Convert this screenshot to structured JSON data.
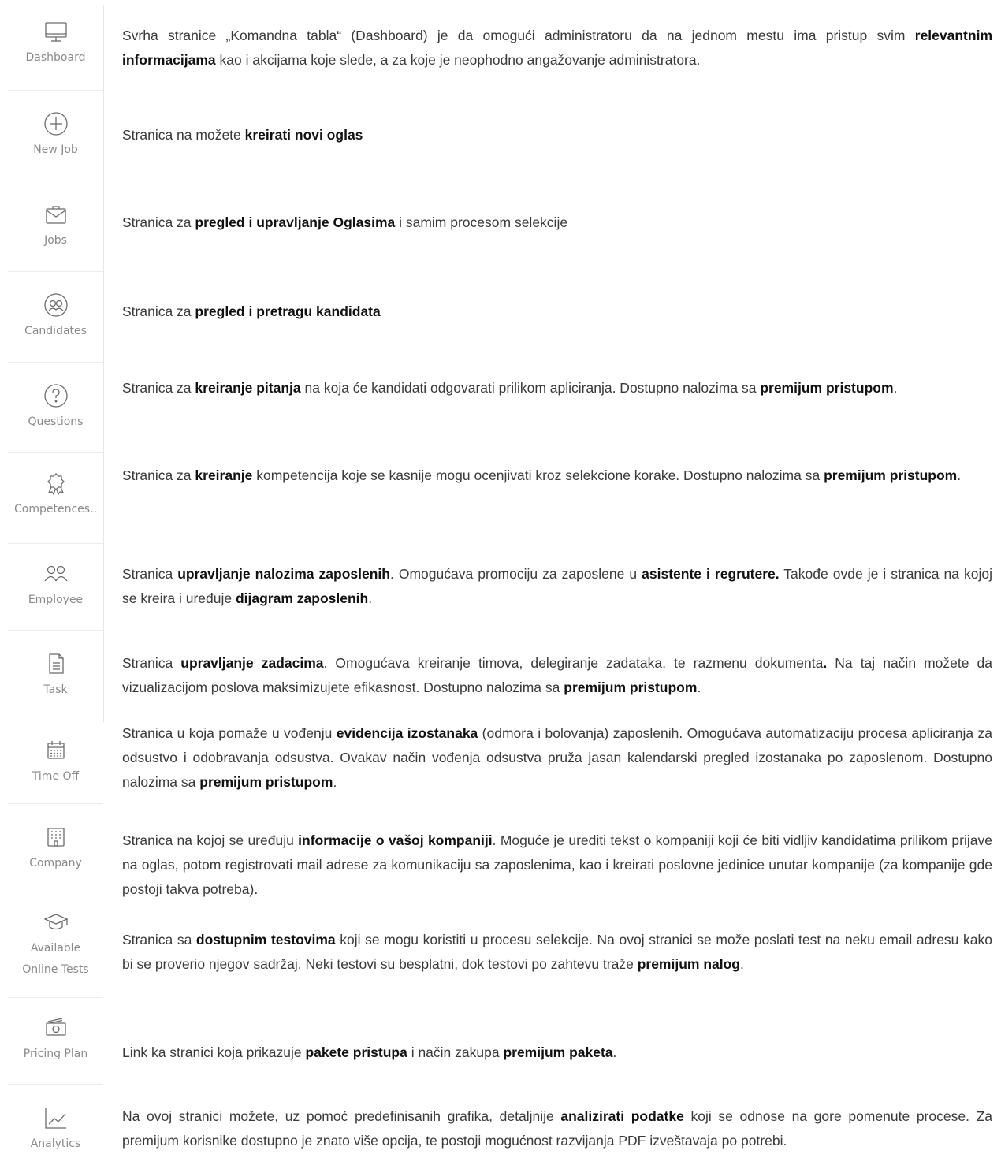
{
  "sidebar": {
    "items": [
      {
        "label": "Dashboard",
        "icon": "monitor-icon"
      },
      {
        "label": "New Job",
        "icon": "plus-circle-icon"
      },
      {
        "label": "Jobs",
        "icon": "briefcase-icon"
      },
      {
        "label": "Candidates",
        "icon": "candidates-icon"
      },
      {
        "label": "Questions",
        "icon": "question-circle-icon"
      },
      {
        "label": "Competences..",
        "icon": "award-icon"
      },
      {
        "label": "Employee",
        "icon": "users-icon"
      },
      {
        "label": "Task",
        "icon": "document-icon"
      },
      {
        "label": "Time Off",
        "icon": "calendar-icon"
      },
      {
        "label": "Company",
        "icon": "building-icon"
      },
      {
        "label": "Available Online Tests",
        "icon": "graduation-cap-icon"
      },
      {
        "label": "Pricing Plan",
        "icon": "money-icon"
      },
      {
        "label": "Analytics",
        "icon": "chart-line-icon"
      }
    ]
  },
  "descriptions": [
    [
      {
        "t": "Svrha stranice „Komandna tabla“ (Dashboard) je da omogući administratoru da na jednom mestu ima pristup svim "
      },
      {
        "t": "relevantnim informacijama",
        "b": true
      },
      {
        "t": " kao i akcijama koje slede, a za koje je neophodno angažovanje administratora."
      }
    ],
    [
      {
        "t": "Stranica na možete "
      },
      {
        "t": "kreirati novi oglas",
        "b": true
      }
    ],
    [
      {
        "t": "Stranica za "
      },
      {
        "t": "pregled i upravljanje Oglasima",
        "b": true
      },
      {
        "t": " i samim procesom selekcije"
      }
    ],
    [
      {
        "t": "Stranica za "
      },
      {
        "t": "pregled i pretragu kandidata",
        "b": true
      }
    ],
    [
      {
        "t": "Stranica za "
      },
      {
        "t": "kreiranje pitanja",
        "b": true
      },
      {
        "t": " na koja će kandidati odgovarati prilikom apliciranja. Dostupno nalozima sa "
      },
      {
        "t": "premijum pristupom",
        "b": true
      },
      {
        "t": "."
      }
    ],
    [
      {
        "t": "Stranica za "
      },
      {
        "t": "kreiranje",
        "b": true
      },
      {
        "t": " kompetencija koje se kasnije mogu ocenjivati kroz selekcione korake. Dostupno nalozima sa "
      },
      {
        "t": "premijum pristupom",
        "b": true
      },
      {
        "t": "."
      }
    ],
    [
      {
        "t": "Stranica "
      },
      {
        "t": "upravljanje nalozima zaposlenih",
        "b": true
      },
      {
        "t": ". Omogućava promociju za zaposlene u "
      },
      {
        "t": "asistente i regrutere.",
        "b": true
      },
      {
        "t": " Takođe ovde je i stranica na kojoj se kreira i uređuje "
      },
      {
        "t": "dijagram zaposlenih",
        "b": true
      },
      {
        "t": "."
      }
    ],
    [
      {
        "t": "Stranica "
      },
      {
        "t": "upravljanje zadacima",
        "b": true
      },
      {
        "t": ". Omogućava kreiranje timova, delegiranje zadataka, te razmenu dokumenta"
      },
      {
        "t": ".",
        "b": true
      },
      {
        "t": " Na taj način možete da vizualizacijom poslova maksimizujete efikasnost. Dostupno nalozima sa "
      },
      {
        "t": "premijum pristupom",
        "b": true
      },
      {
        "t": "."
      }
    ],
    [
      {
        "t": "Stranica u koja pomaže u vođenju "
      },
      {
        "t": "evidencija izostanaka",
        "b": true
      },
      {
        "t": " (odmora i bolovanja) zaposlenih. Omogućava automatizaciju procesa apliciranja za odsustvo i odobravanja odsustva. Ovakav način vođenja odsustva pruža jasan kalendarski pregled izostanaka po zaposlenom. Dostupno nalozima sa "
      },
      {
        "t": "premijum pristupom",
        "b": true
      },
      {
        "t": "."
      }
    ],
    [
      {
        "t": "Stranica na kojoj se uređuju "
      },
      {
        "t": "informacije o vašoj kompaniji",
        "b": true
      },
      {
        "t": ".  Moguće je urediti tekst o kompaniji koji će biti vidljiv kandidatima prilikom prijave na oglas, potom registrovati mail adrese za komunikaciju sa zaposlenima, kao i kreirati poslovne jedinice unutar kompanije (za kompanije gde postoji takva potreba)."
      }
    ],
    [
      {
        "t": "Stranica sa "
      },
      {
        "t": "dostupnim testovima",
        "b": true
      },
      {
        "t": " koji se mogu koristiti u procesu selekcije. Na ovoj stranici se može poslati test na neku email adresu kako bi se proverio njegov sadržaj. Neki testovi su besplatni, dok testovi po zahtevu traže "
      },
      {
        "t": "premijum nalog",
        "b": true
      },
      {
        "t": "."
      }
    ],
    [
      {
        "t": "Link ka stranici koja prikazuje "
      },
      {
        "t": "pakete pristupa",
        "b": true
      },
      {
        "t": " i način zakupa "
      },
      {
        "t": "premijum paketa",
        "b": true
      },
      {
        "t": "."
      }
    ],
    [
      {
        "t": "Na ovoj stranici možete, uz pomoć predefinisanih grafika,  detaljnije "
      },
      {
        "t": "analizirati podatke",
        "b": true
      },
      {
        "t": " koji se odnose na gore pomenute procese. Za premijum korisnike dostupno je znato više opcija, te postoji mogućnost razvijanja PDF izveštavaja po potrebi."
      }
    ]
  ]
}
